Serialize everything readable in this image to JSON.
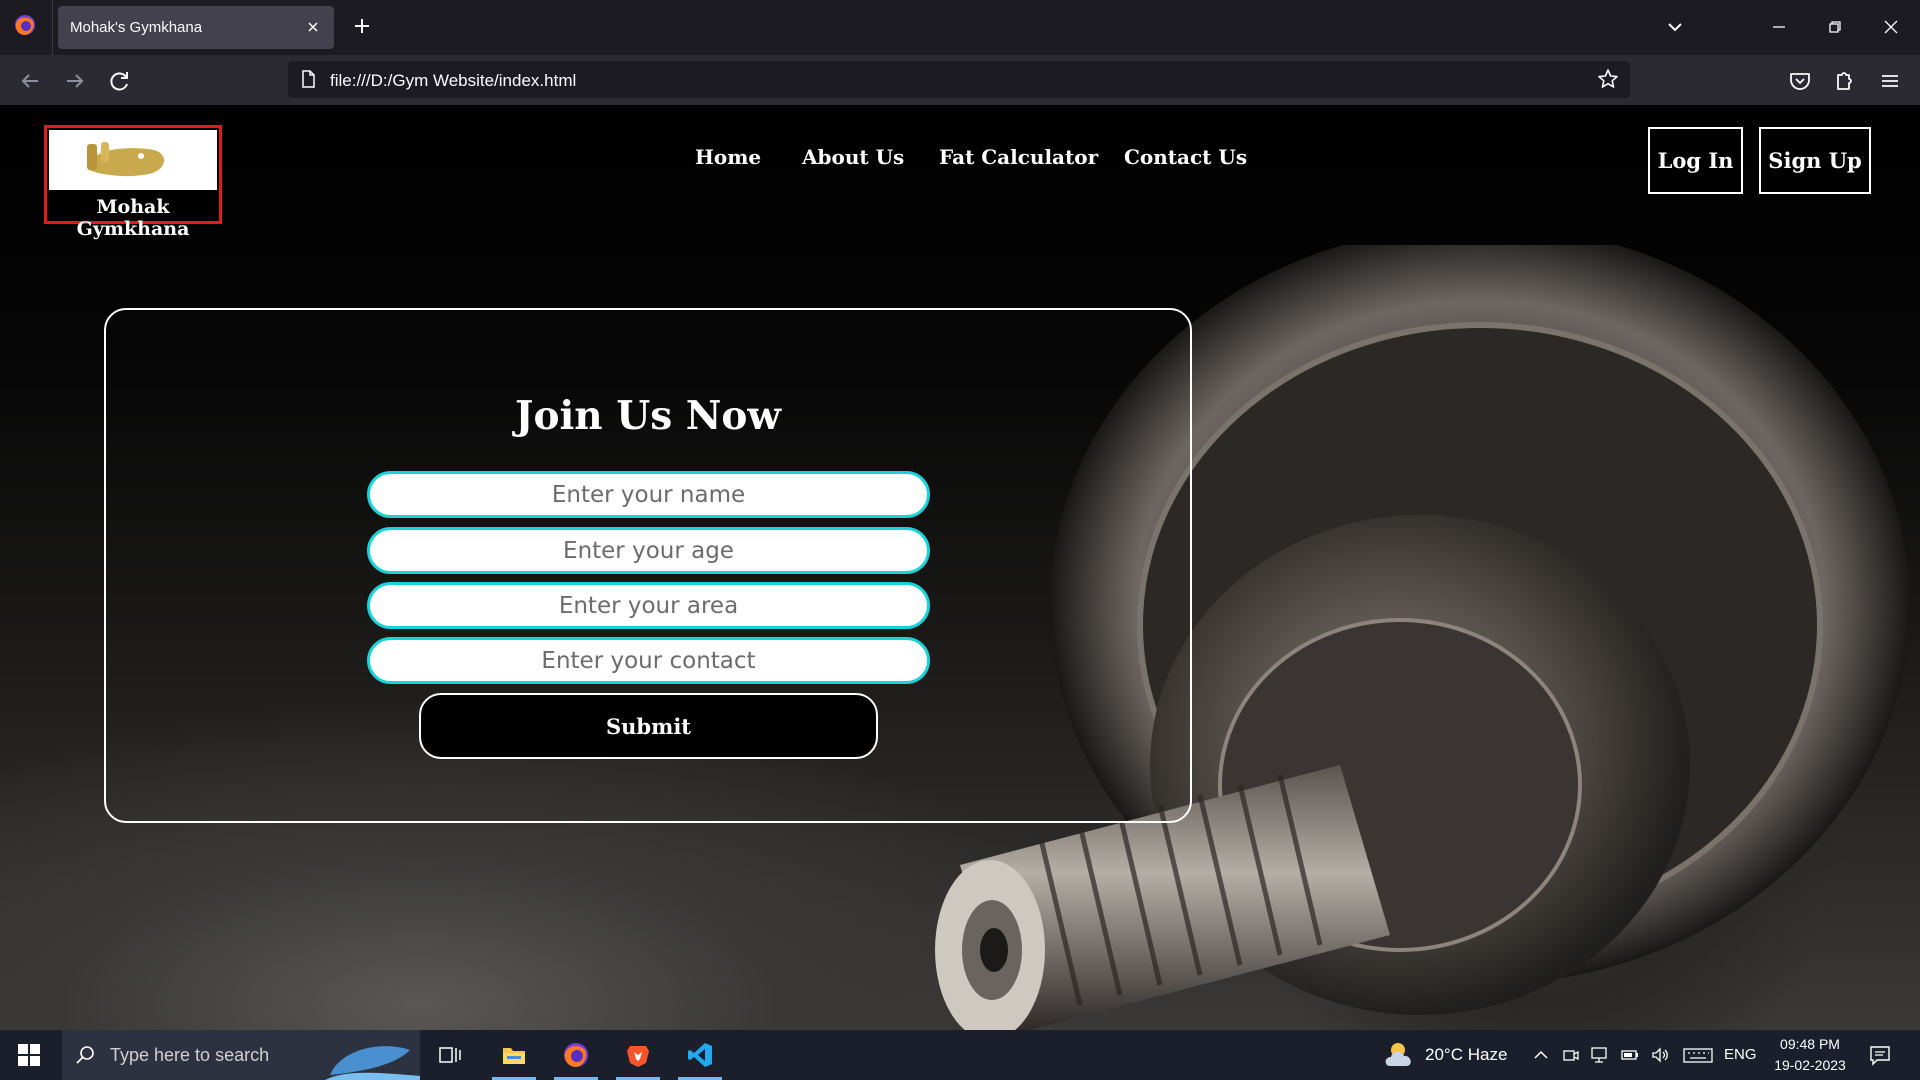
{
  "browser": {
    "tab_title": "Mohak's Gymkhana",
    "url": "file:///D:/Gym Website/index.html"
  },
  "site": {
    "logo_text": "Mohak Gymkhana",
    "menu": [
      "Home",
      "About Us",
      "Fat Calculator",
      "Contact Us"
    ],
    "login_label": "Log In",
    "signup_label": "Sign Up"
  },
  "form": {
    "title": "Join Us Now",
    "name_placeholder": "Enter your name",
    "age_placeholder": "Enter your age",
    "area_placeholder": "Enter your area",
    "contact_placeholder": "Enter your contact",
    "submit_label": "Submit",
    "field_border_color": "#19d3da"
  },
  "taskbar": {
    "search_placeholder": "Type here to search",
    "weather": "20°C  Haze",
    "language": "ENG",
    "time": "09:48 PM",
    "date": "19-02-2023"
  }
}
